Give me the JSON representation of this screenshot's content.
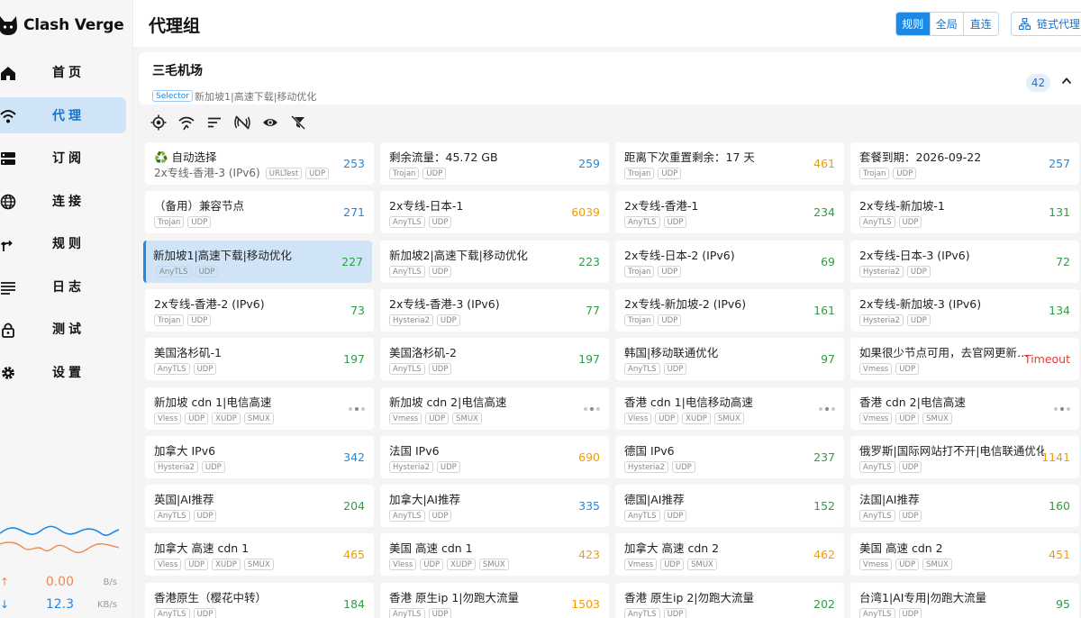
{
  "app": {
    "name": "Clash Verge"
  },
  "sidebar": {
    "items": [
      {
        "label": "首页",
        "icon": "home-icon"
      },
      {
        "label": "代理",
        "icon": "wifi-icon"
      },
      {
        "label": "订阅",
        "icon": "dns-icon"
      },
      {
        "label": "连接",
        "icon": "globe-icon"
      },
      {
        "label": "规则",
        "icon": "route-icon"
      },
      {
        "label": "日志",
        "icon": "list-icon"
      },
      {
        "label": "测试",
        "icon": "lock-icon"
      },
      {
        "label": "设置",
        "icon": "gear-icon"
      }
    ],
    "active_index": 1,
    "traffic": {
      "up_value": "0.00",
      "up_unit": "B/s",
      "up_arrow": "↑",
      "down_value": "12.3",
      "down_unit": "KB/s",
      "down_arrow": "↓"
    }
  },
  "header": {
    "title": "代理组",
    "modes": [
      "规则",
      "全局",
      "直连"
    ],
    "active_mode": 0,
    "chain_label": "链式代理"
  },
  "group": {
    "name": "三毛机场",
    "type": "Selector",
    "now": "新加坡1|高速下载|移动优化",
    "count": "42"
  },
  "colors": {
    "accent": "#1e88e5",
    "delay_fast": "#2e9d45",
    "delay_medium": "#1e88e5",
    "delay_slow": "#f59b00",
    "timeout": "#e53935"
  },
  "toolbar": [
    "locate-icon",
    "wifi-test-icon",
    "sort-icon",
    "filter-off-icon",
    "eye-icon",
    "no-filter-icon"
  ],
  "proxies": [
    {
      "name": "♻️ 自动选择",
      "subtitle": "2x专线-香港-3 (IPv6)",
      "tags": [
        "URLTest",
        "UDP"
      ],
      "delay": "253",
      "delay_color": "#1e88e5"
    },
    {
      "name": "剩余流量：45.72 GB",
      "tags": [
        "Trojan",
        "UDP"
      ],
      "delay": "259",
      "delay_color": "#1e88e5"
    },
    {
      "name": "距离下次重置剩余：17 天",
      "tags": [
        "Trojan",
        "UDP"
      ],
      "delay": "461",
      "delay_color": "#f59b00"
    },
    {
      "name": "套餐到期：2026-09-22",
      "tags": [
        "Trojan",
        "UDP"
      ],
      "delay": "257",
      "delay_color": "#1e88e5"
    },
    {
      "name": "（备用）兼容节点",
      "tags": [
        "Trojan",
        "UDP"
      ],
      "delay": "271",
      "delay_color": "#1e88e5"
    },
    {
      "name": "2x专线-日本-1",
      "tags": [
        "AnyTLS",
        "UDP"
      ],
      "delay": "6039",
      "delay_color": "#f59b00"
    },
    {
      "name": "2x专线-香港-1",
      "tags": [
        "AnyTLS",
        "UDP"
      ],
      "delay": "234",
      "delay_color": "#2e9d45"
    },
    {
      "name": "2x专线-新加坡-1",
      "tags": [
        "AnyTLS",
        "UDP"
      ],
      "delay": "131",
      "delay_color": "#2e9d45"
    },
    {
      "name": "新加坡1|高速下载|移动优化",
      "tags": [
        "AnyTLS",
        "UDP"
      ],
      "delay": "227",
      "delay_color": "#2e9d45",
      "selected": true
    },
    {
      "name": "新加坡2|高速下载|移动优化",
      "tags": [
        "AnyTLS",
        "UDP"
      ],
      "delay": "223",
      "delay_color": "#2e9d45"
    },
    {
      "name": "2x专线-日本-2 (IPv6)",
      "tags": [
        "Trojan",
        "UDP"
      ],
      "delay": "69",
      "delay_color": "#2e9d45"
    },
    {
      "name": "2x专线-日本-3 (IPv6)",
      "tags": [
        "Hysteria2",
        "UDP"
      ],
      "delay": "72",
      "delay_color": "#2e9d45"
    },
    {
      "name": "2x专线-香港-2 (IPv6)",
      "tags": [
        "Trojan",
        "UDP"
      ],
      "delay": "73",
      "delay_color": "#2e9d45"
    },
    {
      "name": "2x专线-香港-3 (IPv6)",
      "tags": [
        "Hysteria2",
        "UDP"
      ],
      "delay": "77",
      "delay_color": "#2e9d45"
    },
    {
      "name": "2x专线-新加坡-2 (IPv6)",
      "tags": [
        "Trojan",
        "UDP"
      ],
      "delay": "161",
      "delay_color": "#2e9d45"
    },
    {
      "name": "2x专线-新加坡-3 (IPv6)",
      "tags": [
        "Hysteria2",
        "UDP"
      ],
      "delay": "134",
      "delay_color": "#2e9d45"
    },
    {
      "name": "美国洛杉矶-1",
      "tags": [
        "AnyTLS",
        "UDP"
      ],
      "delay": "197",
      "delay_color": "#2e9d45"
    },
    {
      "name": "美国洛杉矶-2",
      "tags": [
        "AnyTLS",
        "UDP"
      ],
      "delay": "197",
      "delay_color": "#2e9d45"
    },
    {
      "name": "韩国|移动联通优化",
      "tags": [
        "AnyTLS",
        "UDP"
      ],
      "delay": "97",
      "delay_color": "#2e9d45"
    },
    {
      "name": "如果很少节点可用，去官网更新…",
      "tags": [
        "Vmess",
        "UDP"
      ],
      "delay": "Timeout",
      "delay_color": "#e53935"
    },
    {
      "name": "新加坡 cdn 1|电信高速",
      "tags": [
        "Vless",
        "UDP",
        "XUDP",
        "SMUX"
      ],
      "dots": true
    },
    {
      "name": "新加坡 cdn 2|电信高速",
      "tags": [
        "Vmess",
        "UDP",
        "SMUX"
      ],
      "dots": true
    },
    {
      "name": "香港 cdn 1|电信移动高速",
      "tags": [
        "Vless",
        "UDP",
        "XUDP",
        "SMUX"
      ],
      "dots": true
    },
    {
      "name": "香港 cdn 2|电信高速",
      "tags": [
        "Vmess",
        "UDP",
        "SMUX"
      ],
      "dots": true
    },
    {
      "name": "加拿大 IPv6",
      "tags": [
        "Hysteria2",
        "UDP"
      ],
      "delay": "342",
      "delay_color": "#1e88e5"
    },
    {
      "name": "法国 IPv6",
      "tags": [
        "Hysteria2",
        "UDP"
      ],
      "delay": "690",
      "delay_color": "#f59b00"
    },
    {
      "name": "德国 IPv6",
      "tags": [
        "Hysteria2",
        "UDP"
      ],
      "delay": "237",
      "delay_color": "#2e9d45"
    },
    {
      "name": "俄罗斯|国际网站打不开|电信联通优化",
      "tags": [
        "AnyTLS",
        "UDP"
      ],
      "delay": "1141",
      "delay_color": "#f59b00"
    },
    {
      "name": "英国|AI推荐",
      "tags": [
        "AnyTLS",
        "UDP"
      ],
      "delay": "204",
      "delay_color": "#2e9d45"
    },
    {
      "name": "加拿大|AI推荐",
      "tags": [
        "AnyTLS",
        "UDP"
      ],
      "delay": "335",
      "delay_color": "#1e88e5"
    },
    {
      "name": "德国|AI推荐",
      "tags": [
        "AnyTLS",
        "UDP"
      ],
      "delay": "152",
      "delay_color": "#2e9d45"
    },
    {
      "name": "法国|AI推荐",
      "tags": [
        "AnyTLS",
        "UDP"
      ],
      "delay": "160",
      "delay_color": "#2e9d45"
    },
    {
      "name": "加拿大 高速 cdn 1",
      "tags": [
        "Vless",
        "UDP",
        "XUDP",
        "SMUX"
      ],
      "delay": "465",
      "delay_color": "#f59b00"
    },
    {
      "name": "美国 高速 cdn 1",
      "tags": [
        "Vless",
        "UDP",
        "XUDP",
        "SMUX"
      ],
      "delay": "423",
      "delay_color": "#f59b00"
    },
    {
      "name": "加拿大 高速 cdn 2",
      "tags": [
        "Vmess",
        "UDP",
        "SMUX"
      ],
      "delay": "462",
      "delay_color": "#f59b00"
    },
    {
      "name": "美国 高速 cdn 2",
      "tags": [
        "Vmess",
        "UDP",
        "SMUX"
      ],
      "delay": "451",
      "delay_color": "#f59b00"
    },
    {
      "name": "香港原生（樱花中转）",
      "tags": [
        "AnyTLS",
        "UDP"
      ],
      "delay": "184",
      "delay_color": "#2e9d45"
    },
    {
      "name": "香港 原生ip 1|勿跑大流量",
      "tags": [
        "AnyTLS",
        "UDP"
      ],
      "delay": "1503",
      "delay_color": "#f59b00"
    },
    {
      "name": "香港 原生ip 2|勿跑大流量",
      "tags": [
        "AnyTLS",
        "UDP"
      ],
      "delay": "202",
      "delay_color": "#2e9d45"
    },
    {
      "name": "台湾1|AI专用|勿跑大流量",
      "tags": [
        "AnyTLS",
        "UDP"
      ],
      "delay": "95",
      "delay_color": "#2e9d45"
    }
  ]
}
